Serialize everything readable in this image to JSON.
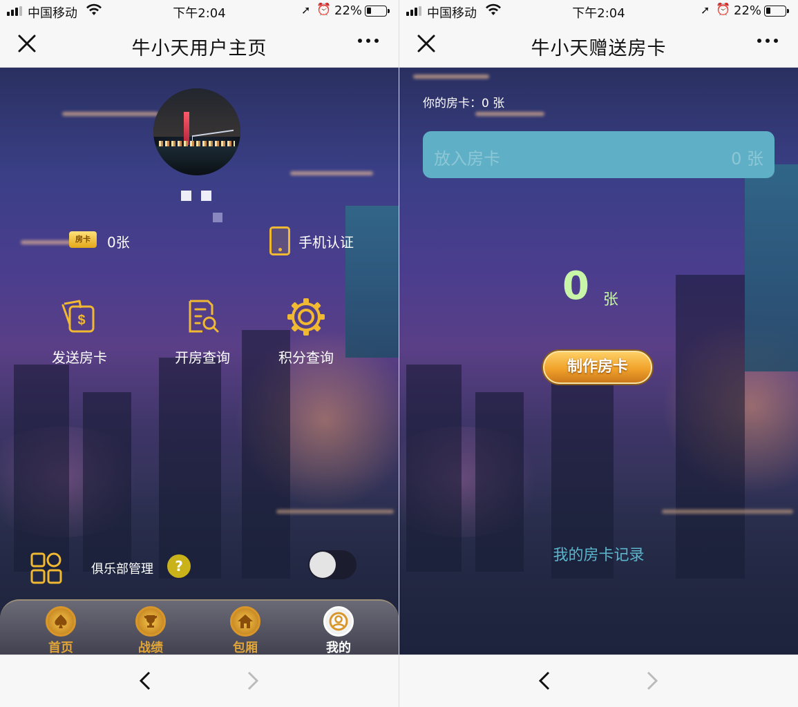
{
  "status": {
    "carrier": "中国移动",
    "time": "下午2:04",
    "battery_pct": "22%",
    "battery_level": 0.22,
    "icons": [
      "signal-icon",
      "wifi-icon",
      "location-arrow-icon",
      "alarm-icon",
      "battery-icon"
    ]
  },
  "left": {
    "navbar": {
      "title": "牛小天用户主页"
    },
    "profile": {
      "card_badge": "房卡",
      "card_count": "0张",
      "phone_verify": "手机认证"
    },
    "features": [
      {
        "label": "发送房卡",
        "icon": "send-card-icon"
      },
      {
        "label": "开房查询",
        "icon": "room-search-icon"
      },
      {
        "label": "积分查询",
        "icon": "gear-icon"
      }
    ],
    "club": {
      "label": "俱乐部管理",
      "help": "?"
    },
    "tabs": [
      {
        "label": "首页",
        "icon": "spade-icon"
      },
      {
        "label": "战绩",
        "icon": "trophy-icon"
      },
      {
        "label": "包厢",
        "icon": "house-icon"
      },
      {
        "label": "我的",
        "icon": "user-icon",
        "active": true
      }
    ]
  },
  "right": {
    "navbar": {
      "title": "牛小天赠送房卡"
    },
    "your_cards": "你的房卡：0 张",
    "input": {
      "placeholder": "放入房卡",
      "value": "0",
      "unit": "张"
    },
    "big_value": "0",
    "big_unit": "张",
    "make_button": "制作房卡",
    "record_link": "我的房卡记录"
  },
  "colors": {
    "gold": "#f1b931",
    "input_bg": "#5fb0c6",
    "big_number": "#c8f5a8",
    "link": "#5bb6cd",
    "help_badge": "#c9b21a"
  }
}
